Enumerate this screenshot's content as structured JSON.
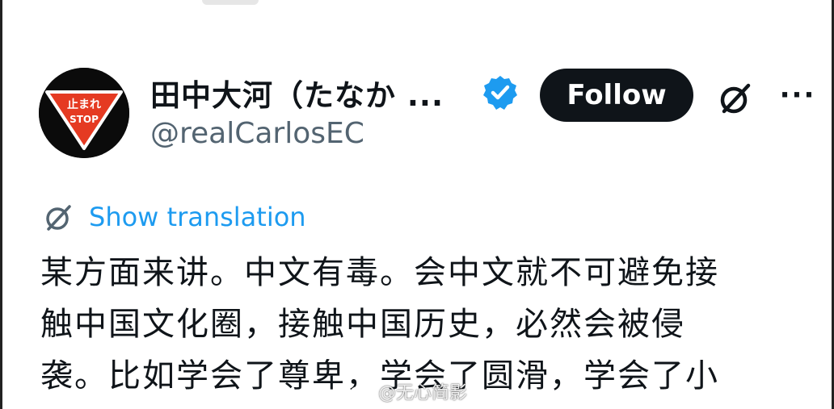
{
  "profile": {
    "display_name": "田中大河（たなか ...",
    "handle": "@realCarlosEC",
    "avatar_sign_top": "止まれ",
    "avatar_sign_bottom": "STOP",
    "verified": true
  },
  "actions": {
    "follow_label": "Follow",
    "more_label": "···"
  },
  "translation": {
    "label": "Show translation"
  },
  "tweet": {
    "lines": [
      "某方面来讲。中文有毒。会中文就不可避免接",
      "触中国文化圈，接触中国历史，必然会被侵",
      "袭。比如学会了尊卑，学会了圆滑，学会了小"
    ]
  },
  "watermark": {
    "text": "@无心简影"
  },
  "colors": {
    "accent": "#1d9bf0",
    "text": "#0f1419",
    "secondary_text": "#536471",
    "follow_bg": "#0f1419"
  },
  "icons": {
    "verified": "verified-badge-icon",
    "grok": "grok-icon",
    "translate": "grok-translate-icon"
  }
}
